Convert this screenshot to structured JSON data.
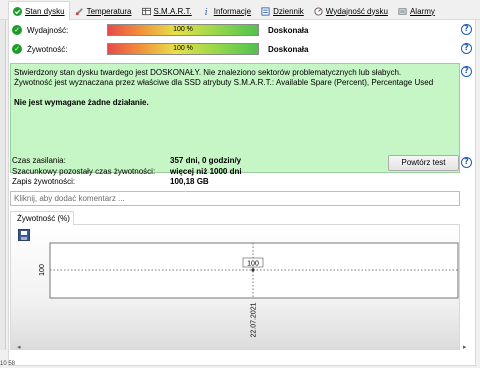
{
  "tabs": [
    {
      "label": "Stan dysku",
      "active": true,
      "icon": "check-icon"
    },
    {
      "label": "Temperatura",
      "active": false,
      "icon": "thermometer-icon"
    },
    {
      "label": "S.M.A.R.T.",
      "active": false,
      "icon": "smart-table-icon"
    },
    {
      "label": "Informacje",
      "active": false,
      "icon": "info-icon"
    },
    {
      "label": "Dziennik",
      "active": false,
      "icon": "log-icon"
    },
    {
      "label": "Wydajność dysku",
      "active": false,
      "icon": "performance-icon"
    },
    {
      "label": "Alarmy",
      "active": false,
      "icon": "alarm-icon"
    }
  ],
  "performance": {
    "label": "Wydajność:",
    "percent_text": "100 %",
    "value": 100,
    "status": "Doskonała"
  },
  "health": {
    "label": "Żywotność:",
    "percent_text": "100 %",
    "value": 100,
    "status": "Doskonała"
  },
  "status_message": {
    "line1": "Stwierdzony stan dysku twardego jest DOSKONAŁY. Nie znaleziono sektorów problematycznych lub słabych.",
    "line2": "Żywotność jest wyznaczana przez właściwe dla SSD atrybuty S.M.A.R.T.:  Available Spare (Percent), Percentage Used",
    "action": "Nie jest wymagane żadne działanie."
  },
  "info": {
    "power_on_label": "Czas zasilania:",
    "power_on_value": "357 dni, 0 godzin/y",
    "remaining_label": "Szacunkowy pozostały czas żywotności:",
    "remaining_value": "więcej niż 1000 dni",
    "written_label": "Zapis żywotności:",
    "written_value": "100,18 GB"
  },
  "repeat_button": "Powtórz test",
  "comment_placeholder": "Kliknij, aby dodać komentarz ...",
  "chart_tab": "Żywotność (%)",
  "colors": {
    "status_bg": "#c6f5c6",
    "ok_green": "#1c9c2b",
    "help_blue": "#1f5bb8"
  },
  "chart_data": {
    "type": "line",
    "x": [
      "22.07.2021"
    ],
    "series": [
      {
        "values": [
          100
        ]
      }
    ],
    "y_tick_label": "100",
    "point_label": "100"
  },
  "corner": "10 58"
}
